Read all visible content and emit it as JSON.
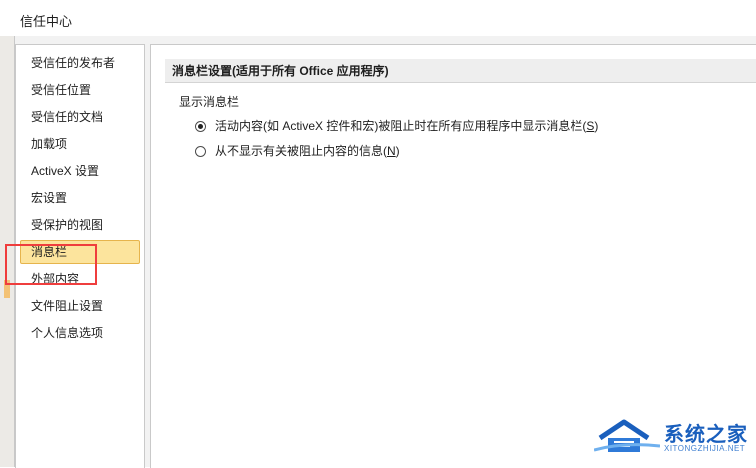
{
  "window": {
    "title": "信任中心"
  },
  "sidebar": {
    "items": [
      {
        "label": "受信任的发布者"
      },
      {
        "label": "受信任位置"
      },
      {
        "label": "受信任的文档"
      },
      {
        "label": "加载项"
      },
      {
        "label": "ActiveX 设置"
      },
      {
        "label": "宏设置"
      },
      {
        "label": "受保护的视图"
      },
      {
        "label": "消息栏",
        "selected": true
      },
      {
        "label": "外部内容"
      },
      {
        "label": "文件阻止设置"
      },
      {
        "label": "个人信息选项"
      }
    ]
  },
  "main": {
    "section_title": "消息栏设置(适用于所有 Office 应用程序)",
    "group_label": "显示消息栏",
    "options": [
      {
        "text_before": "活动内容(如 ActiveX 控件和宏)被阻止时在所有应用程序中显示消息栏(",
        "accesskey": "S",
        "text_after": ")",
        "checked": true
      },
      {
        "text_before": "从不显示有关被阻止内容的信息(",
        "accesskey": "N",
        "text_after": ")",
        "checked": false
      }
    ]
  },
  "watermark": {
    "name": "系统之家",
    "url": "XITONGZHIJIA.NET"
  },
  "colors": {
    "selected_bg": "#fce49d",
    "selected_border": "#e6b44c",
    "annotation": "#ef3d3d",
    "watermark": "#1a5fbd"
  }
}
